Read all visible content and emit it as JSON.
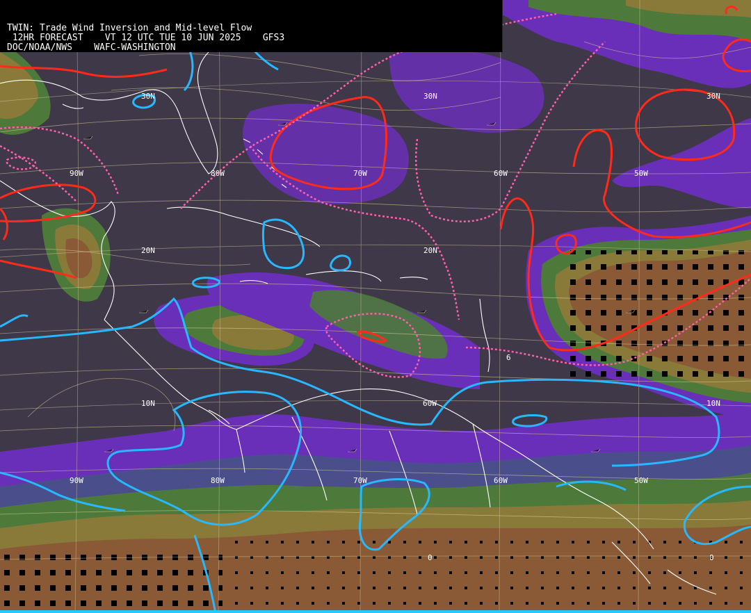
{
  "header": {
    "title": "TWIN: Trade Wind Inversion and Mid-level Flow",
    "forecast": " 12HR FORECAST    VT 12 UTC TUE 10 JUN 2025    GFS3",
    "agency": "DOC/NOAA/NWS    WAFC-WASHINGTON"
  },
  "grid_labels": {
    "lat_30n_a": "30N",
    "lat_30n_b": "30N",
    "lat_30n_c": "30N",
    "lat_20n_a": "20N",
    "lat_20n_b": "20N",
    "lat_10n_a": "10N",
    "lat_10n_b": "10N",
    "lon_90w_a": "90W",
    "lon_80w_a": "80W",
    "lon_70w_a": "70W",
    "lon_60w_a": "60W",
    "lon_50w_a": "50W",
    "lon_90w_b": "90W",
    "lon_80w_b": "80W",
    "lon_70w_b": "70W",
    "lon_60w_b": "60W",
    "lon_50w_b": "50W",
    "lon_60w_c": "60W",
    "lat_0_a": "0",
    "lat_0_b": "0",
    "contour_6": "6"
  },
  "colors": {
    "background": "#3f3848",
    "purple": "#6a2fb8",
    "blue_slate": "#4a4f8c",
    "green": "#4d7a3a",
    "olive": "#8a7a3a",
    "brown": "#8a5a36",
    "red_contour": "#ff2a1a",
    "pink_dashed": "#ff5fae",
    "cyan_contour": "#27b8ff",
    "coastline": "#ffffff",
    "gridline": "#d8d0a0"
  }
}
